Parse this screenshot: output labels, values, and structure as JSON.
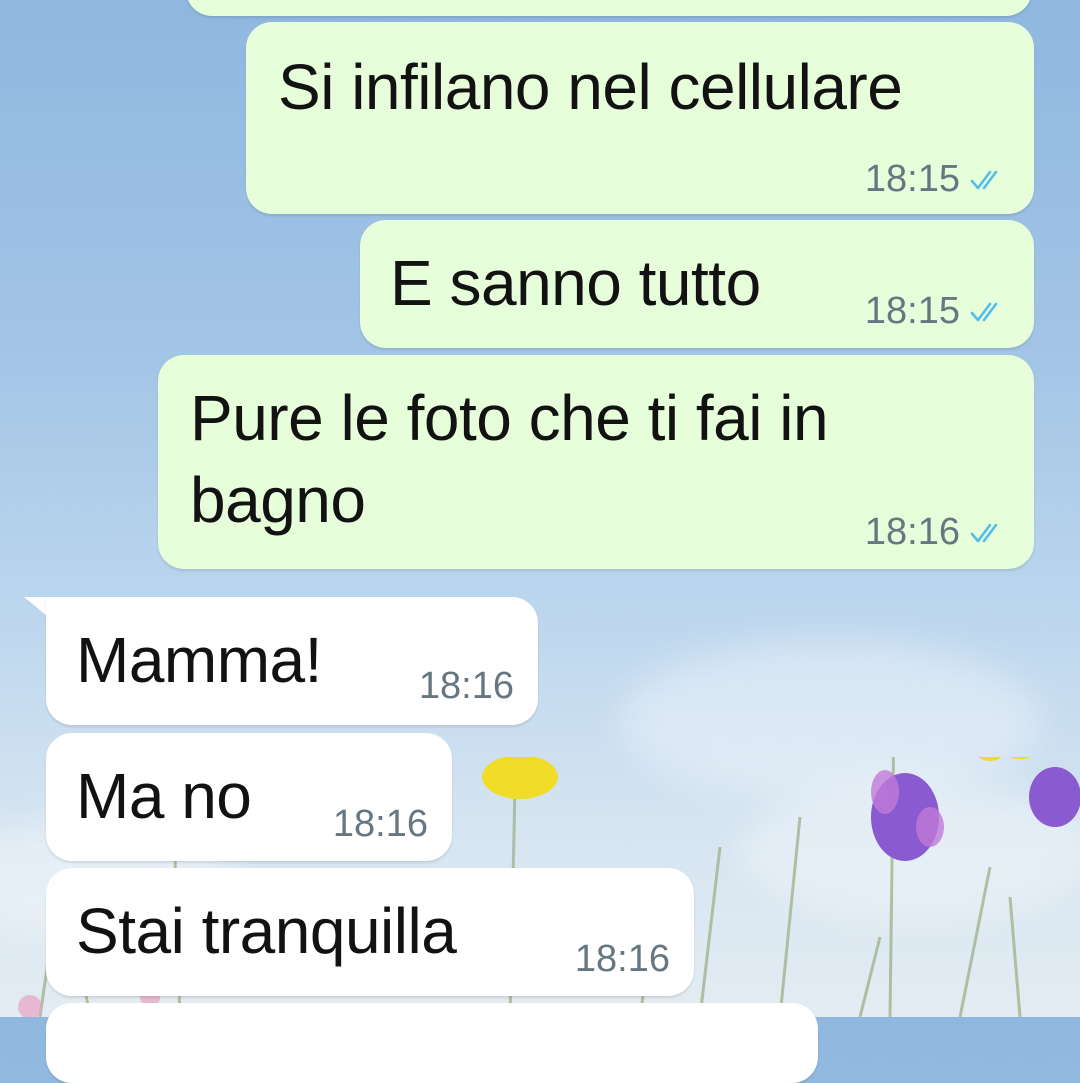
{
  "messages": [
    {
      "text": "",
      "time": "",
      "direction": "out",
      "status": ""
    },
    {
      "text": "Si infilano nel cellulare",
      "time": "18:15",
      "direction": "out",
      "status": "read"
    },
    {
      "text": "E sanno tutto",
      "time": "18:15",
      "direction": "out",
      "status": "read"
    },
    {
      "text": "Pure le foto che ti fai in bagno",
      "time": "18:16",
      "direction": "out",
      "status": "read"
    },
    {
      "text": "Mamma!",
      "time": "18:16",
      "direction": "in"
    },
    {
      "text": "Ma no",
      "time": "18:16",
      "direction": "in"
    },
    {
      "text": "Stai tranquilla",
      "time": "18:16",
      "direction": "in"
    }
  ],
  "colors": {
    "outgoing_bubble": "#e6ffda",
    "incoming_bubble": "#ffffff",
    "read_ticks": "#53bdeb",
    "timestamp": "#667781",
    "text": "#121212"
  },
  "icons": {
    "read_receipt": "double-check-icon"
  }
}
